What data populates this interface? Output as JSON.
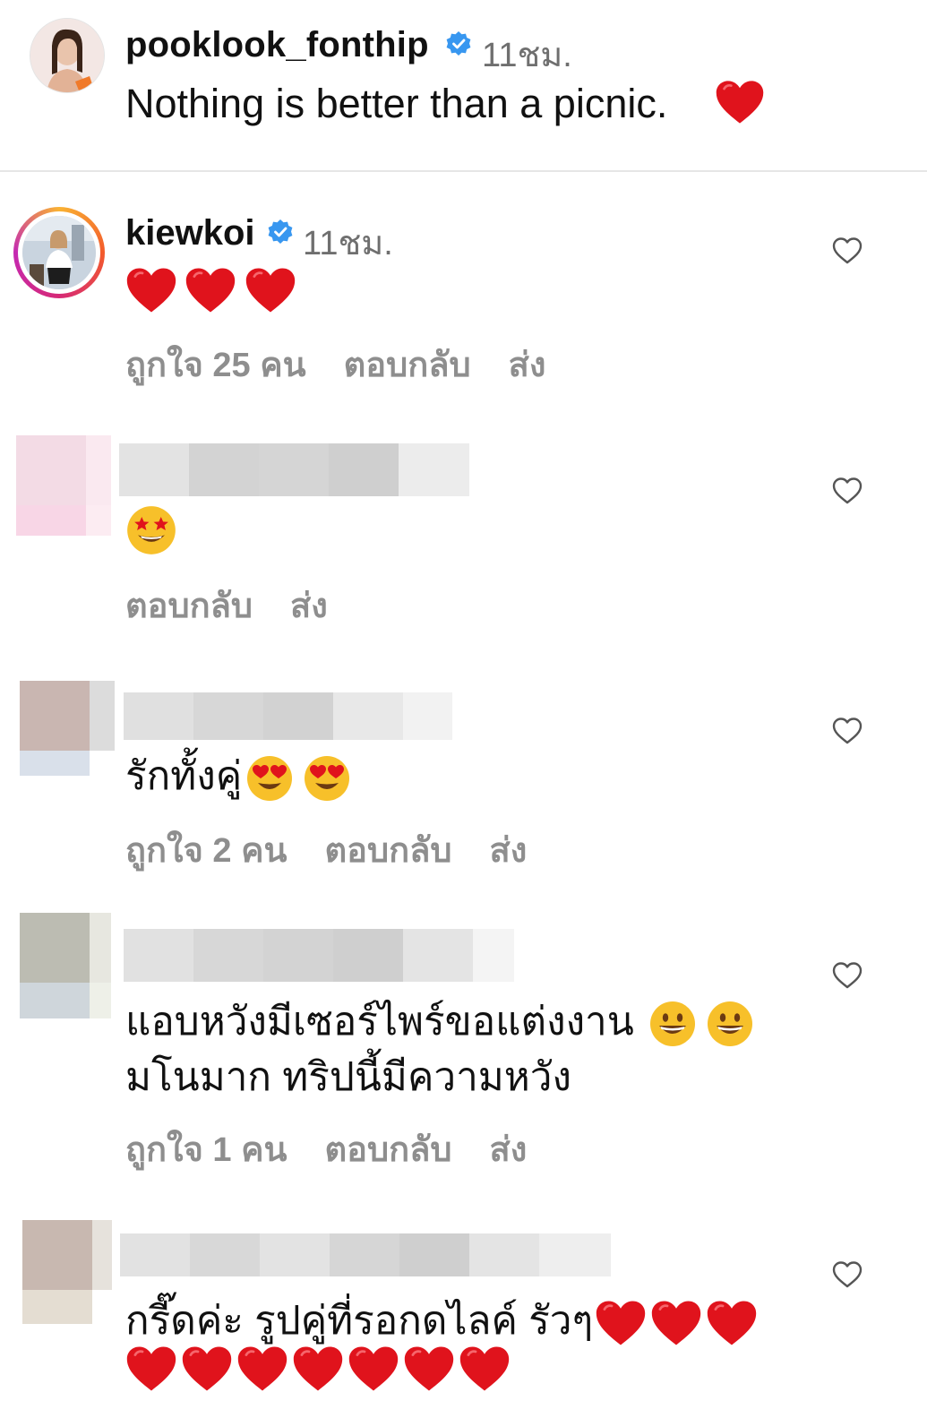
{
  "caption": {
    "username": "pooklook_fonthip",
    "verified_icon": "verified-badge-icon",
    "time": "11ชม.",
    "text": "Nothing is better than a picnic.",
    "emoji": "red-heart"
  },
  "colors": {
    "verified": "#3897f0",
    "heart": "#e0131c",
    "secondary_text": "#8e8e8e",
    "divider": "#e6e6e6"
  },
  "comments": [
    {
      "username": "kiewkoi",
      "verified": true,
      "time": "11ชม.",
      "text": "",
      "emojis": [
        "red-heart",
        "red-heart",
        "red-heart"
      ],
      "likes": "ถูกใจ 25 คน",
      "reply": "ตอบกลับ",
      "send": "ส่ง",
      "like_icon": "heart-outline-icon"
    },
    {
      "username_hidden": true,
      "text": "",
      "emojis": [
        "star-struck-face"
      ],
      "reply": "ตอบกลับ",
      "send": "ส่ง",
      "like_icon": "heart-outline-icon"
    },
    {
      "username_hidden": true,
      "text": "รักทั้งคู่",
      "emojis": [
        "heart-eyes-face",
        "heart-eyes-face"
      ],
      "likes": "ถูกใจ 2 คน",
      "reply": "ตอบกลับ",
      "send": "ส่ง",
      "like_icon": "heart-outline-icon"
    },
    {
      "username_hidden": true,
      "text_line1": "แอบหวังมีเซอร์ไพร์ขอแต่งงาน",
      "text_line2": "มโนมาก ทริปนี้มีความหวัง",
      "emojis": [
        "grinning-face",
        "grinning-face"
      ],
      "likes": "ถูกใจ 1 คน",
      "reply": "ตอบกลับ",
      "send": "ส่ง",
      "like_icon": "heart-outline-icon"
    },
    {
      "username_hidden": true,
      "text_line1": "กรี๊ดค่ะ รูปคู่ที่รอกดไลค์ รัวๆ",
      "emojis": [
        "red-heart",
        "red-heart",
        "red-heart",
        "red-heart",
        "red-heart",
        "red-heart",
        "red-heart",
        "red-heart",
        "red-heart",
        "red-heart"
      ],
      "like_icon": "heart-outline-icon"
    }
  ]
}
